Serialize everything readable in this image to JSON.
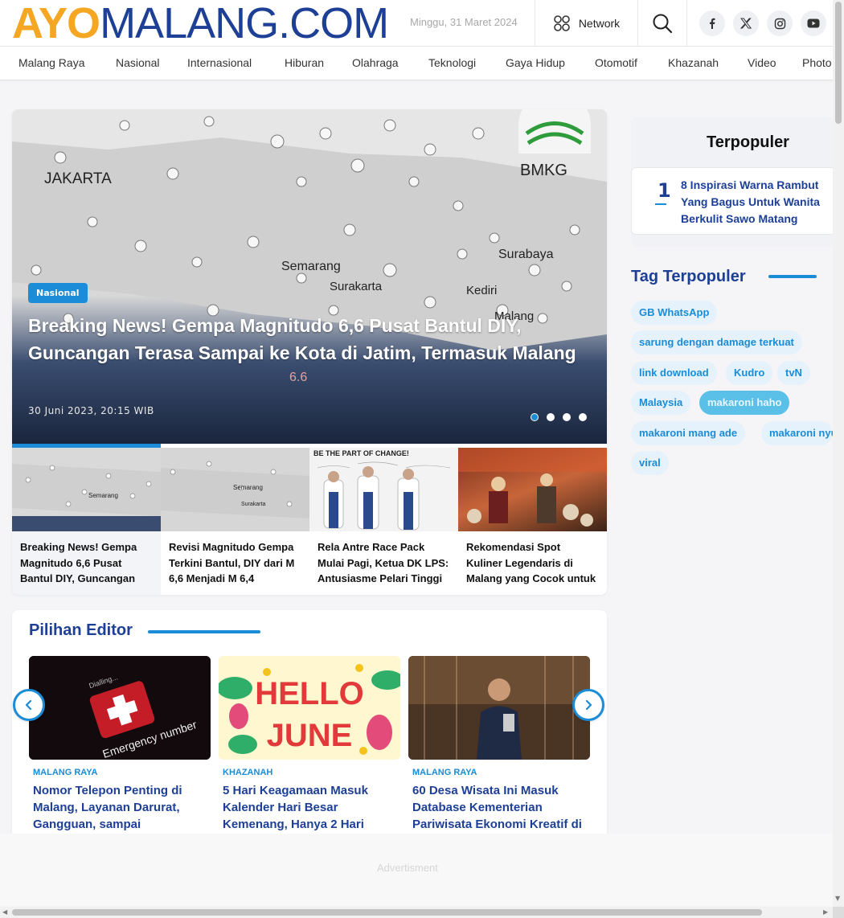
{
  "header": {
    "logo_ayo": "AYO",
    "logo_rest": "MALANG.COM",
    "date": "Minggu, 31 Maret 2024",
    "network_label": "Network"
  },
  "nav": [
    "Malang Raya",
    "Nasional",
    "Internasional",
    "Hiburan",
    "Olahraga",
    "Teknologi",
    "Gaya Hidup",
    "Otomotif",
    "Khazanah",
    "Video",
    "Photo"
  ],
  "hero": {
    "category": "Nasional",
    "title": "Breaking News! Gempa Magnitudo 6,6 Pusat Bantul DIY, Guncangan Terasa Sampai ke Kota di Jatim, Termasuk Malang",
    "date": "30 Juni 2023, 20:15 WIB",
    "map_labels": [
      "JAKARTA",
      "BMKG",
      "Semarang",
      "Surabaya",
      "Surakarta",
      "Kediri",
      "Malang",
      "6.6"
    ],
    "active_slide": 1,
    "slide_count": 4
  },
  "thumbs": [
    {
      "title": "Breaking News! Gempa Magnitudo 6,6 Pusat Bantul DIY, Guncangan Terasa Sampai ke Kota di Jatim",
      "map_labels": [
        "Semarang"
      ]
    },
    {
      "title": "Revisi Magnitudo Gempa Terkini Bantul, DIY dari M 6,6 Menjadi M 6,4",
      "map_labels": [
        "Semarang",
        "Surakarta"
      ]
    },
    {
      "title": "Rela Antre Race Pack Mulai Pagi, Ketua DK LPS: Antusiasme Pelari Tinggi",
      "banner": "BE THE PART OF CHANGE!"
    },
    {
      "title": "Rekomendasi Spot Kuliner Legendaris di Malang yang Cocok untuk Sarapan"
    }
  ],
  "editor": {
    "heading": "Pilihan Editor",
    "cards": [
      {
        "category": "MALANG RAYA",
        "title": "Nomor Telepon Penting di Malang, Layanan Darurat, Gangguan, sampai",
        "image_text": [
          "Dialling...",
          "Emergency number"
        ]
      },
      {
        "category": "KHAZANAH",
        "title": "5 Hari Keagamaan Masuk Kalender Hari Besar Kemenang, Hanya 2 Hari",
        "image_text": [
          "HELLO",
          "JUNE"
        ]
      },
      {
        "category": "MALANG RAYA",
        "title": "60 Desa Wisata Ini Masuk Database Kementerian Pariwisata Ekonomi Kreatif di"
      }
    ]
  },
  "sidebar": {
    "popular_heading": "Terpopuler",
    "popular_items": [
      {
        "rank": "1",
        "title": "8 Inspirasi Warna Rambut Yang Bagus Untuk Wanita Berkulit Sawo Matang"
      }
    ],
    "tags_heading": "Tag Terpopuler",
    "tags": [
      "GB WhatsApp",
      "sarung dengan damage terkuat",
      "link download",
      "Kudro",
      "tvN",
      "Malaysia",
      "makaroni haho",
      "makaroni mang ade",
      "makaroni nyulik",
      "viral"
    ]
  },
  "ad": {
    "label": "Advertisment"
  },
  "colors": {
    "brand_orange": "#f5a623",
    "brand_navy": "#1d3f96",
    "accent_blue": "#1a8cd8"
  }
}
